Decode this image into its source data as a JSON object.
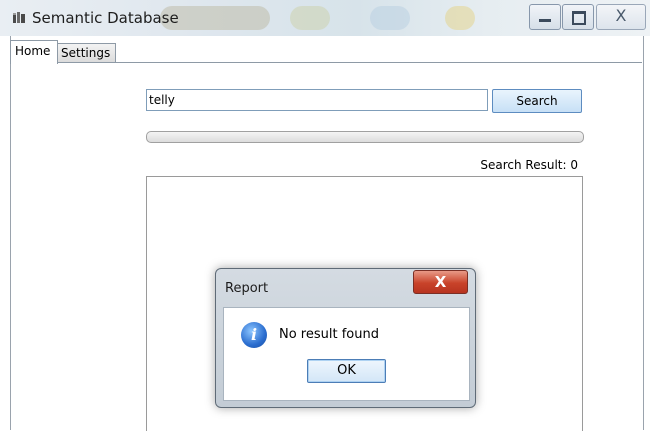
{
  "window": {
    "title": "Semantic Database",
    "icon": "database-icon",
    "controls": [
      "minimize-icon",
      "maximize-icon",
      "close-icon"
    ],
    "close_glyph": "X"
  },
  "tabs": [
    {
      "label": "Home",
      "active": true
    },
    {
      "label": "Settings",
      "active": false
    }
  ],
  "search": {
    "value": "telly",
    "button_label": "Search"
  },
  "progress": {
    "value": 0
  },
  "results": {
    "label": "Search Result: 0"
  },
  "dialog": {
    "title": "Report",
    "close_glyph": "X",
    "icon": "info-icon",
    "icon_glyph": "i",
    "message": "No result found",
    "ok_label": "OK"
  },
  "colors": {
    "close_button": "#c9432a",
    "info_icon": "#2a6dcf"
  }
}
